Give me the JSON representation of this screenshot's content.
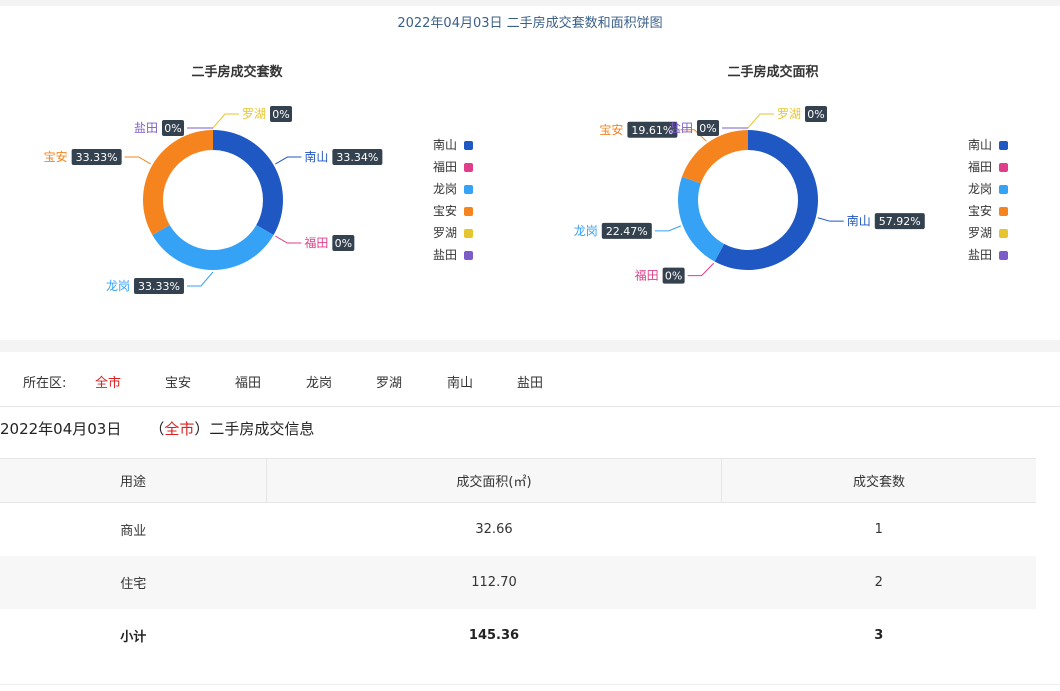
{
  "page_title": "2022年04月03日 二手房成交套数和面积饼图",
  "chart_data": [
    {
      "type": "pie",
      "title": "二手房成交套数",
      "legend_position": "right",
      "slices": [
        {
          "name": "南山",
          "value": 33.34,
          "label": "33.34%",
          "color": "#1f57c3"
        },
        {
          "name": "福田",
          "value": 0,
          "label": "0%",
          "color": "#e03e8a"
        },
        {
          "name": "龙岗",
          "value": 33.33,
          "label": "33.33%",
          "color": "#36a2f5"
        },
        {
          "name": "宝安",
          "value": 33.33,
          "label": "33.33%",
          "color": "#f5841f"
        },
        {
          "name": "罗湖",
          "value": 0,
          "label": "0%",
          "color": "#e6c62e"
        },
        {
          "name": "盐田",
          "value": 0,
          "label": "0%",
          "color": "#7b5cc9"
        }
      ]
    },
    {
      "type": "pie",
      "title": "二手房成交面积",
      "legend_position": "right",
      "slices": [
        {
          "name": "南山",
          "value": 57.92,
          "label": "57.92%",
          "color": "#1f57c3"
        },
        {
          "name": "福田",
          "value": 0,
          "label": "0%",
          "color": "#e03e8a"
        },
        {
          "name": "龙岗",
          "value": 22.47,
          "label": "22.47%",
          "color": "#36a2f5"
        },
        {
          "name": "宝安",
          "value": 19.61,
          "label": "19.61%",
          "color": "#f5841f"
        },
        {
          "name": "罗湖",
          "value": 0,
          "label": "0%",
          "color": "#e6c62e"
        },
        {
          "name": "盐田",
          "value": 0,
          "label": "0%",
          "color": "#7b5cc9"
        }
      ]
    }
  ],
  "filter": {
    "label": "所在区:",
    "items": [
      "全市",
      "宝安",
      "福田",
      "龙岗",
      "罗湖",
      "南山",
      "盐田"
    ],
    "active": "全市"
  },
  "info": {
    "date": "2022年04月03日",
    "open_paren": "（",
    "city": "全市",
    "close_paren": "）",
    "title": "二手房成交信息"
  },
  "table": {
    "headers": [
      "用途",
      "成交面积(㎡)",
      "成交套数"
    ],
    "rows": [
      [
        "商业",
        "32.66",
        "1"
      ],
      [
        "住宅",
        "112.70",
        "2"
      ]
    ],
    "total": [
      "小计",
      "145.36",
      "3"
    ]
  }
}
